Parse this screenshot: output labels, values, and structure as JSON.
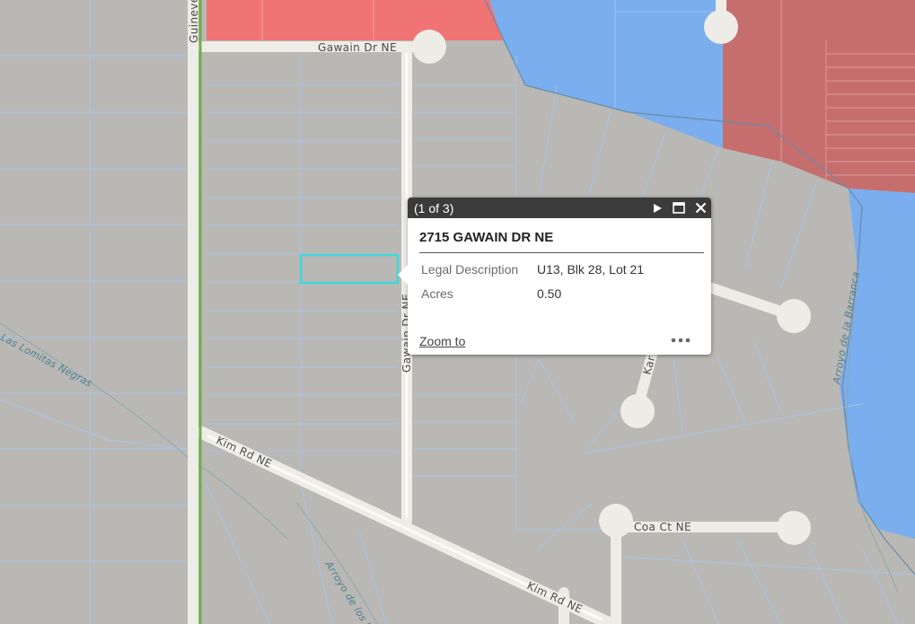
{
  "map": {
    "roads": {
      "gawain_top": "Gawain Dr NE",
      "gawain_vertical": "Gawain Dr NE",
      "guinevere": "Guineve",
      "kim_upper": "Kim Rd NE",
      "kim_lower": "Kim Rd NE",
      "coa_ct": "Coa Ct NE",
      "kar_partial": "Kar"
    },
    "water": {
      "lomitas": "Las Lomitas Negras",
      "barrancas": "Arroyo de la Barranca",
      "arroyo_lower": "Arroyo de los L"
    },
    "colors": {
      "base": "#b9b8b5",
      "parcel_line": "#a7c4e6",
      "zone_red": "#f07474",
      "zone_red_dark": "#c66e6e",
      "zone_blue": "#7aaeee",
      "road": "#eeece6",
      "green_line": "#6fae4a",
      "selection": "#3fd8d8"
    }
  },
  "popup": {
    "count": "(1 of 3)",
    "title": "2715 GAWAIN DR NE",
    "fields": [
      {
        "key": "Legal Description",
        "value": "U13, Blk 28, Lot 21"
      },
      {
        "key": "Acres",
        "value": "0.50"
      }
    ],
    "zoom_label": "Zoom to",
    "icons": {
      "next": "play-icon",
      "maximize": "maximize-icon",
      "close": "close-icon",
      "more": "more-icon"
    }
  }
}
